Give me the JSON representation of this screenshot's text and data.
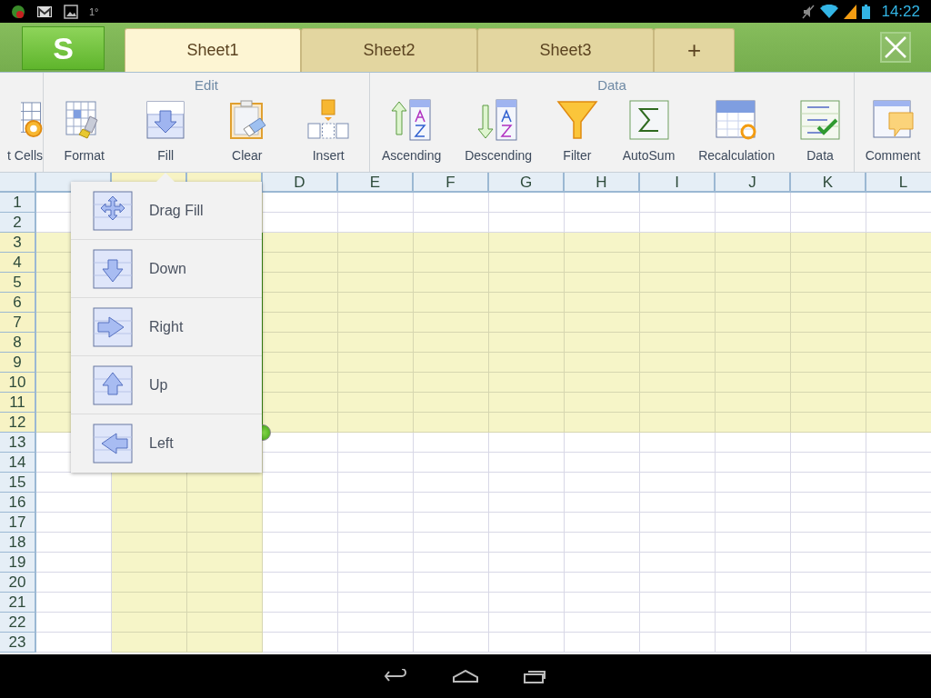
{
  "status_bar": {
    "notification_text": "1°",
    "time": "14:22"
  },
  "app_logo": "S",
  "sheet_tabs": [
    {
      "label": "Sheet1",
      "selected": true
    },
    {
      "label": "Sheet2",
      "selected": false
    },
    {
      "label": "Sheet3",
      "selected": false
    }
  ],
  "add_sheet": "+",
  "toolbar": [
    {
      "items": [
        {
          "label": "t Cells"
        }
      ]
    },
    {
      "title": "Edit",
      "items": [
        {
          "label": "Format"
        },
        {
          "label": "Fill"
        },
        {
          "label": "Clear"
        },
        {
          "label": "Insert"
        }
      ]
    },
    {
      "title": "Data",
      "items": [
        {
          "label": "Ascending"
        },
        {
          "label": "Descending"
        },
        {
          "label": "Filter"
        },
        {
          "label": "AutoSum"
        },
        {
          "label": "Recalculation"
        },
        {
          "label": "Data"
        }
      ]
    },
    {
      "items": [
        {
          "label": "Comment"
        }
      ]
    }
  ],
  "columns": [
    {
      "selected": false
    },
    {
      "selected": true
    },
    {
      "selected": true
    },
    {
      "label": "D",
      "selected": false
    },
    {
      "label": "E",
      "selected": false
    },
    {
      "label": "F",
      "selected": false
    },
    {
      "label": "G",
      "selected": false
    },
    {
      "label": "H",
      "selected": false
    },
    {
      "label": "I",
      "selected": false
    },
    {
      "label": "J",
      "selected": false
    },
    {
      "label": "K",
      "selected": false
    },
    {
      "label": "L",
      "selected": false
    }
  ],
  "rows": [
    {
      "label": "1",
      "selected": false
    },
    {
      "label": "2",
      "selected": false
    },
    {
      "label": "3",
      "selected": true
    },
    {
      "label": "4",
      "selected": true
    },
    {
      "label": "5",
      "selected": true
    },
    {
      "label": "6",
      "selected": true
    },
    {
      "label": "7",
      "selected": true
    },
    {
      "label": "8",
      "selected": true
    },
    {
      "label": "9",
      "selected": true
    },
    {
      "label": "10",
      "selected": true
    },
    {
      "label": "11",
      "selected": true
    },
    {
      "label": "12",
      "selected": true
    },
    {
      "label": "13",
      "selected": false
    },
    {
      "label": "14",
      "selected": false
    },
    {
      "label": "15",
      "selected": false
    },
    {
      "label": "16",
      "selected": false
    },
    {
      "label": "17",
      "selected": false
    },
    {
      "label": "18",
      "selected": false
    },
    {
      "label": "19",
      "selected": false
    },
    {
      "label": "20",
      "selected": false
    },
    {
      "label": "21",
      "selected": false
    },
    {
      "label": "22",
      "selected": false
    },
    {
      "label": "23",
      "selected": false
    }
  ],
  "fill_menu": {
    "items": [
      {
        "label": "Drag Fill"
      },
      {
        "label": "Down"
      },
      {
        "label": "Right"
      },
      {
        "label": "Up"
      },
      {
        "label": "Left"
      }
    ]
  }
}
